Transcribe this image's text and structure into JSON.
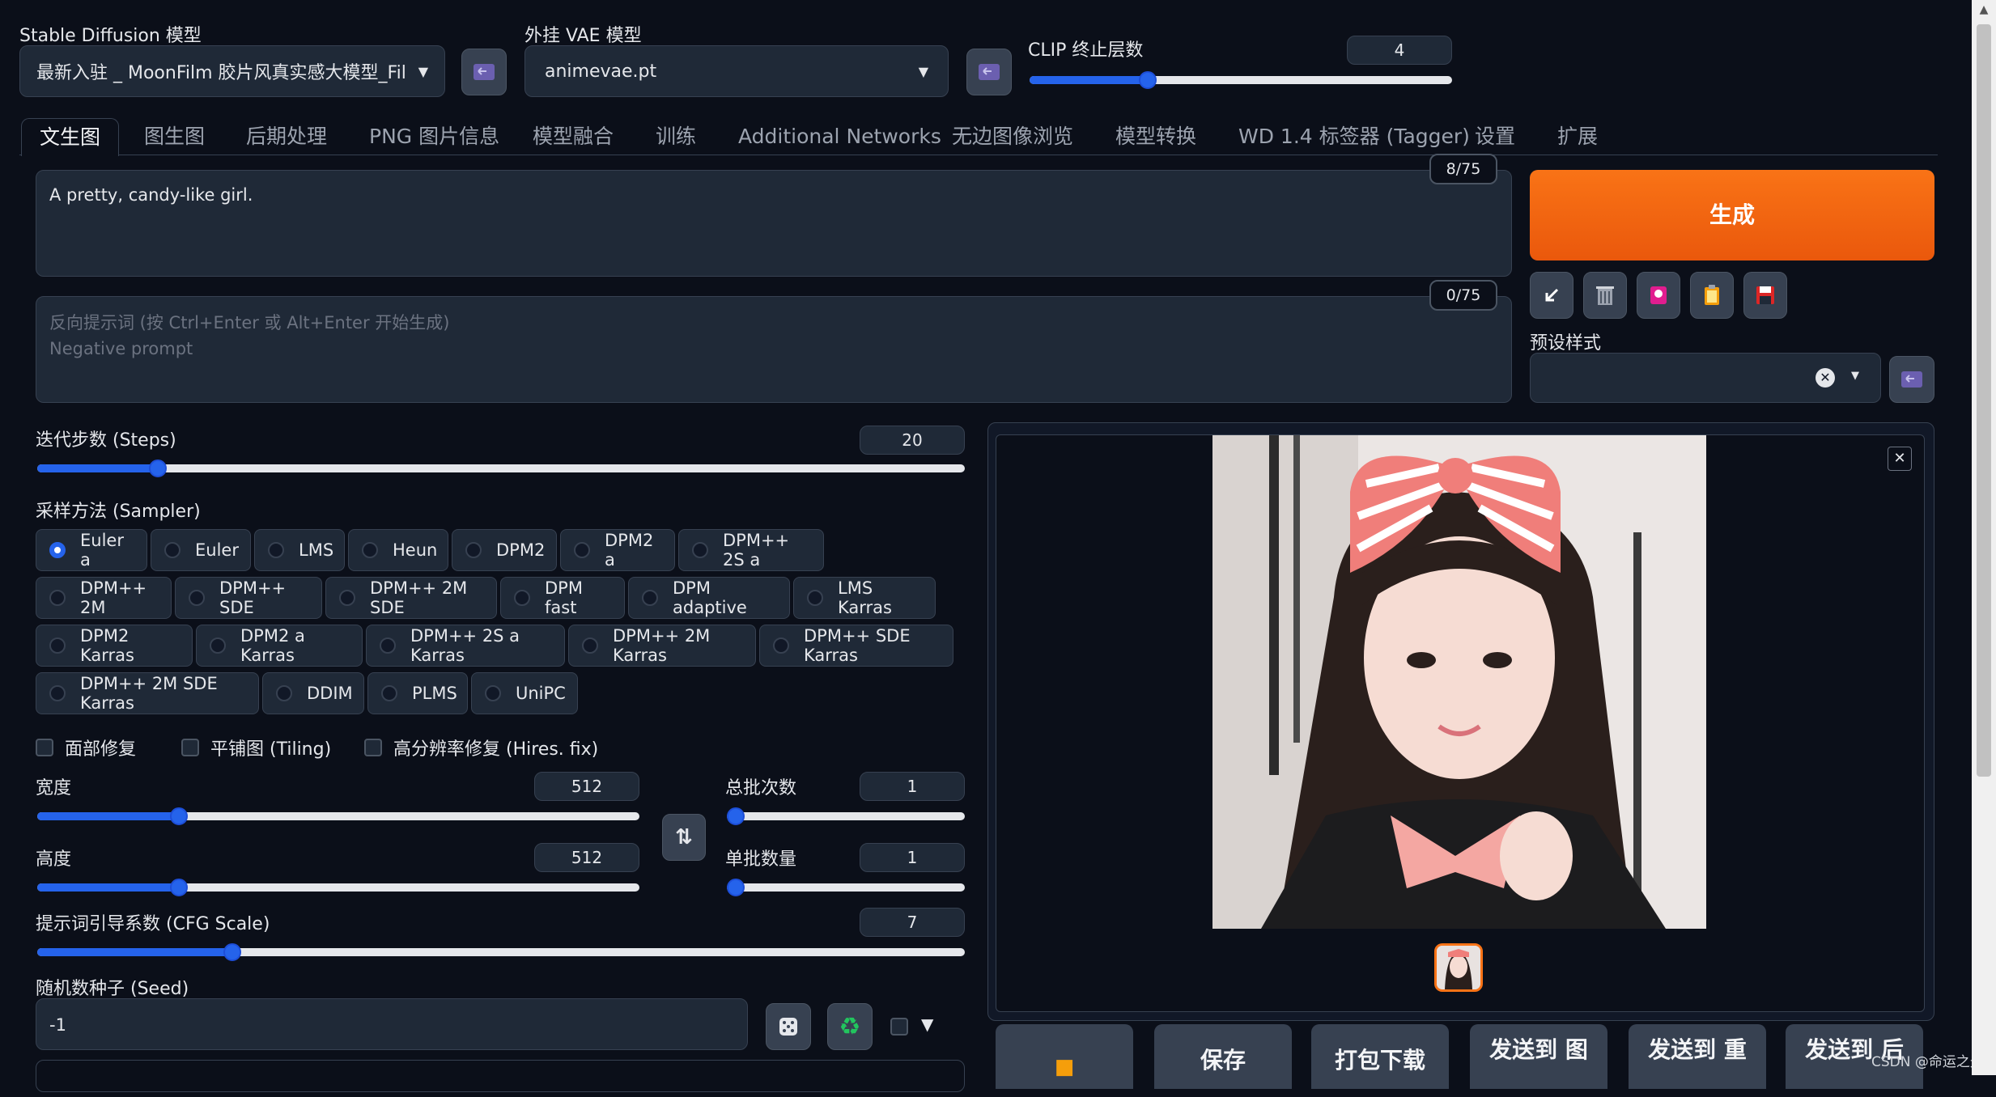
{
  "model": {
    "sd_label": "Stable Diffusion 模型",
    "sd_value": "最新入驻 _ MoonFilm 胶片风真实感大模型_Fil",
    "vae_label": "外挂 VAE 模型",
    "vae_value": "animevae.pt",
    "clip_label": "CLIP 终止层数",
    "clip_value": "4",
    "clip_fraction": 0.28
  },
  "tabs": [
    "文生图",
    "图生图",
    "后期处理",
    "PNG 图片信息",
    "模型融合",
    "训练",
    "Additional Networks",
    "无边图像浏览",
    "模型转换",
    "WD 1.4 标签器 (Tagger)",
    "设置",
    "扩展"
  ],
  "prompt": {
    "text": "A pretty, candy-like girl.",
    "counter": "8/75",
    "neg_placeholder_1": "反向提示词 (按 Ctrl+Enter 或 Alt+Enter 开始生成)",
    "neg_placeholder_2": "Negative prompt",
    "neg_counter": "0/75"
  },
  "generate_label": "生成",
  "preset_label": "预设样式",
  "steps": {
    "label": "迭代步数 (Steps)",
    "value": "20",
    "fraction": 0.13
  },
  "sampler": {
    "label": "采样方法 (Sampler)",
    "selected": "Euler a",
    "options": [
      "Euler a",
      "Euler",
      "LMS",
      "Heun",
      "DPM2",
      "DPM2 a",
      "DPM++ 2S a",
      "DPM++ 2M",
      "DPM++ SDE",
      "DPM++ 2M SDE",
      "DPM fast",
      "DPM adaptive",
      "LMS Karras",
      "DPM2 Karras",
      "DPM2 a Karras",
      "DPM++ 2S a Karras",
      "DPM++ 2M Karras",
      "DPM++ SDE Karras",
      "DPM++ 2M SDE Karras",
      "DDIM",
      "PLMS",
      "UniPC"
    ]
  },
  "checks": {
    "face": "面部修复",
    "tiling": "平铺图 (Tiling)",
    "hires": "高分辨率修复 (Hires. fix)"
  },
  "width": {
    "label": "宽度",
    "value": "512",
    "fraction": 0.235
  },
  "height": {
    "label": "高度",
    "value": "512",
    "fraction": 0.235
  },
  "batch_count": {
    "label": "总批次数",
    "value": "1",
    "fraction": 0.0
  },
  "batch_size": {
    "label": "单批数量",
    "value": "1",
    "fraction": 0.0
  },
  "cfg": {
    "label": "提示词引导系数 (CFG Scale)",
    "value": "7",
    "fraction": 0.21
  },
  "seed": {
    "label": "随机数种子 (Seed)",
    "value": "-1"
  },
  "output_buttons": [
    "保存",
    "打包下载",
    "发送到 图",
    "发送到 重",
    "发送到 后"
  ],
  "watermark": "CSDN @命运之光",
  "colors": {
    "generate": "#f97316",
    "accent": "#2563eb",
    "background": "#0b0f19"
  }
}
